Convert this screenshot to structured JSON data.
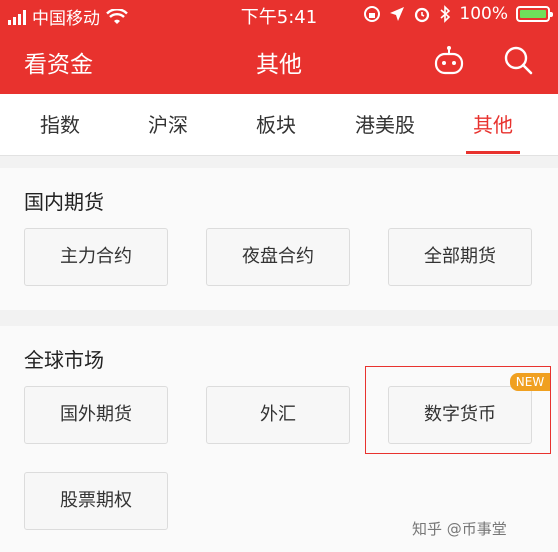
{
  "status_bar": {
    "carrier": "中国移动",
    "time": "下午5:41",
    "battery": "100%",
    "signal_icon": "signal-bars-icon",
    "wifi_icon": "wifi-icon"
  },
  "header": {
    "brand": "看资金",
    "title": "其他",
    "robot_icon": "robot-icon",
    "search_icon": "search-icon"
  },
  "tabs": [
    {
      "label": "指数",
      "active": false
    },
    {
      "label": "沪深",
      "active": false
    },
    {
      "label": "板块",
      "active": false
    },
    {
      "label": "港美股",
      "active": false
    },
    {
      "label": "其他",
      "active": true
    }
  ],
  "sections": {
    "domestic": {
      "title": "国内期货",
      "buttons": [
        "主力合约",
        "夜盘合约",
        "全部期货"
      ]
    },
    "global": {
      "title": "全球市场",
      "buttons": [
        "国外期货",
        "外汇",
        "数字货币",
        "股票期权"
      ],
      "new_badge": "NEW"
    }
  },
  "watermark": "知乎 @币事堂",
  "colors": {
    "accent": "#e8322e",
    "badge": "#f0a020",
    "battery": "#6fe05b"
  }
}
